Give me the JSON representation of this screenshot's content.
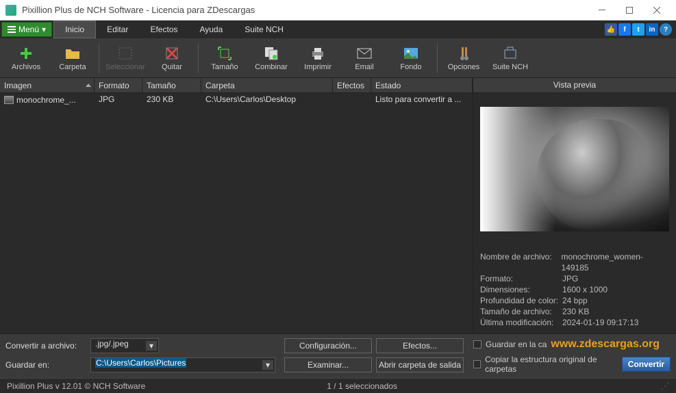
{
  "window": {
    "title": "Pixillion Plus de NCH Software - Licencia para ZDescargas"
  },
  "menubar": {
    "menu_label": "Menú",
    "items": [
      "Inicio",
      "Editar",
      "Efectos",
      "Ayuda",
      "Suite NCH"
    ],
    "active_index": 0
  },
  "toolbar": {
    "archivos": "Archivos",
    "carpeta": "Carpeta",
    "seleccionar": "Seleccionar",
    "quitar": "Quitar",
    "tamano": "Tamaño",
    "combinar": "Combinar",
    "imprimir": "Imprimir",
    "email": "Email",
    "fondo": "Fondo",
    "opciones": "Opciones",
    "suite": "Suite NCH"
  },
  "columns": {
    "imagen": "Imagen",
    "formato": "Formato",
    "tamano": "Tamaño",
    "carpeta": "Carpeta",
    "efectos": "Efectos",
    "estado": "Estado"
  },
  "rows": [
    {
      "imagen": "monochrome_...",
      "formato": "JPG",
      "tamano": "230 KB",
      "carpeta": "C:\\Users\\Carlos\\Desktop",
      "efectos": "",
      "estado": "Listo para convertir a ..."
    }
  ],
  "preview": {
    "title": "Vista previa",
    "meta": {
      "nombre_lbl": "Nombre de archivo:",
      "nombre_val": "monochrome_women-149185",
      "formato_lbl": "Formato:",
      "formato_val": "JPG",
      "dim_lbl": "Dimensiones:",
      "dim_val": "1600 x 1000",
      "depth_lbl": "Profundidad de color:",
      "depth_val": "24 bpp",
      "size_lbl": "Tamaño de archivo:",
      "size_val": "230 KB",
      "mod_lbl": "Última modificación:",
      "mod_val": "2024-01-19 09:17:13"
    }
  },
  "bottom": {
    "convertir_label": "Convertir a archivo:",
    "format_value": ".jpg/.jpeg",
    "config_btn": "Configuración...",
    "efectos_btn": "Efectos...",
    "guardar_label": "Guardar en:",
    "guardar_value": "C:\\Users\\Carlos\\Pictures",
    "examinar_btn": "Examinar...",
    "abrir_btn": "Abrir carpeta de salida",
    "chk1_label": "Guardar en la ca",
    "chk2_label": "Copiar la estructura original de carpetas",
    "convert_btn": "Convertir",
    "watermark": "www.zdescargas.org"
  },
  "status": {
    "version": "Pixillion Plus v 12.01 © NCH Software",
    "selection": "1 / 1 seleccionados"
  }
}
